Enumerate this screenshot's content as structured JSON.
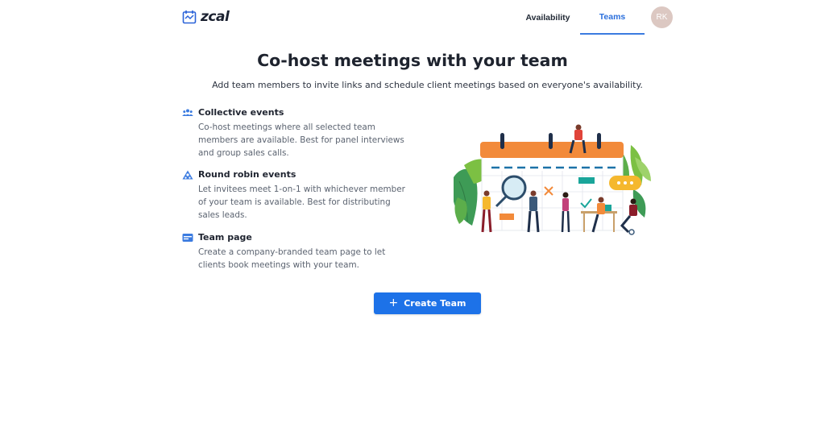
{
  "app": {
    "logo_text": "zcal"
  },
  "nav": {
    "items": [
      {
        "label": "Availability",
        "active": false
      },
      {
        "label": "Teams",
        "active": true
      }
    ],
    "avatar_initials": "RK"
  },
  "main": {
    "title": "Co-host meetings with your team",
    "subtitle": "Add team members to invite links and schedule client meetings based on everyone's availability.",
    "features": [
      {
        "icon": "users-icon",
        "title": "Collective events",
        "description": "Co-host meetings where all selected team members are available. Best for panel interviews and group sales calls."
      },
      {
        "icon": "round-robin-icon",
        "title": "Round robin events",
        "description": "Let invitees meet 1-on-1 with whichever member of your team is available. Best for distributing sales leads."
      },
      {
        "icon": "team-page-icon",
        "title": "Team page",
        "description": "Create a company-branded team page to let clients book meetings with your team."
      }
    ],
    "cta": {
      "icon": "plus-icon",
      "label": "Create Team"
    }
  },
  "colors": {
    "accent": "#1d72e8",
    "active_tab": "#2b6fdc",
    "calendar_header": "#f28a3a",
    "avatar_bg": "#dcc8c2"
  }
}
